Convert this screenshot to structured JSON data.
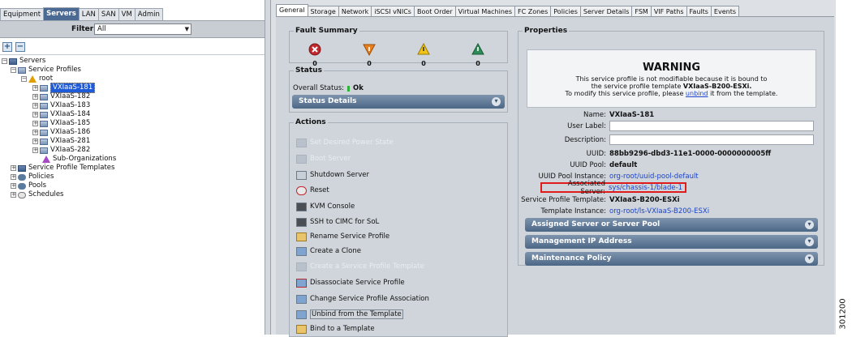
{
  "nav": {
    "tabs": [
      "Equipment",
      "Servers",
      "LAN",
      "SAN",
      "VM",
      "Admin"
    ],
    "active_tab": "Servers",
    "filter_label": "Filter:",
    "filter_value": "All"
  },
  "tree": {
    "servers": "Servers",
    "service_profiles": "Service Profiles",
    "root": "root",
    "profiles": [
      "VXIaaS-181",
      "VXIaaS-182",
      "VXIaaS-183",
      "VXIaaS-184",
      "VXIaaS-185",
      "VXIaaS-186",
      "VXIaaS-281",
      "VXIaaS-282"
    ],
    "sub_orgs": "Sub-Organizations",
    "templates": "Service Profile Templates",
    "policies": "Policies",
    "pools": "Pools",
    "schedules": "Schedules"
  },
  "detail_tabs": [
    "General",
    "Storage",
    "Network",
    "iSCSI vNICs",
    "Boot Order",
    "Virtual Machines",
    "FC Zones",
    "Policies",
    "Server Details",
    "FSM",
    "VIF Paths",
    "Faults",
    "Events"
  ],
  "fault_summary": {
    "title": "Fault Summary",
    "counts": [
      "0",
      "0",
      "0",
      "0"
    ],
    "colors": [
      "#c0282d",
      "#e8811b",
      "#f2c418",
      "#2e8b57"
    ]
  },
  "status": {
    "title": "Status",
    "overall_label": "Overall Status:",
    "overall_value": "Ok",
    "details_bar": "Status Details"
  },
  "actions": {
    "title": "Actions",
    "items": [
      {
        "label": "Set Desired Power State",
        "enabled": false
      },
      {
        "label": "Boot Server",
        "enabled": false
      },
      {
        "label": "Shutdown Server",
        "enabled": true
      },
      {
        "label": "Reset",
        "enabled": true
      },
      {
        "label": "KVM Console",
        "enabled": true
      },
      {
        "label": "SSH to CIMC for SoL",
        "enabled": true
      },
      {
        "label": "Rename Service Profile",
        "enabled": true
      },
      {
        "label": "Create a Clone",
        "enabled": true
      },
      {
        "label": "Create a Service Profile Template",
        "enabled": false
      },
      {
        "label": "Disassociate Service Profile",
        "enabled": true
      },
      {
        "label": "Change Service Profile Association",
        "enabled": true
      },
      {
        "label": "Unbind from the Template",
        "enabled": true
      },
      {
        "label": "Bind to a Template",
        "enabled": true
      }
    ]
  },
  "properties": {
    "title": "Properties",
    "warning_title": "WARNING",
    "warning_line1": "This service profile is not modifiable because it is bound to",
    "warning_line2_prefix": "the service profile template",
    "warning_line2_bold": "VXIaaS-B200-ESXi.",
    "warning_line3_prefix": "To modify this service profile, please",
    "warning_line3_link": "unbind",
    "warning_line3_suffix": "it from the template.",
    "name_label": "Name:",
    "name_value": "VXIaaS-181",
    "user_label_label": "User Label:",
    "description_label": "Description:",
    "uuid_label": "UUID:",
    "uuid_value": "88bb9296-dbd3-11e1-0000-0000000005ff",
    "uuid_pool_label": "UUID Pool:",
    "uuid_pool_value": "default",
    "uuid_pool_instance_label": "UUID Pool Instance:",
    "uuid_pool_instance_value": "org-root/uuid-pool-default",
    "associated_server_label": "Associated Server:",
    "associated_server_value": "sys/chassis-1/blade-1",
    "sp_template_label": "Service Profile Template:",
    "sp_template_value": "VXIaaS-B200-ESXi",
    "template_instance_label": "Template Instance:",
    "template_instance_value": "org-root/ls-VXIaaS-B200-ESXi",
    "bars": [
      "Assigned Server or Server Pool",
      "Management IP Address",
      "Maintenance Policy"
    ]
  },
  "footnote": "301200"
}
